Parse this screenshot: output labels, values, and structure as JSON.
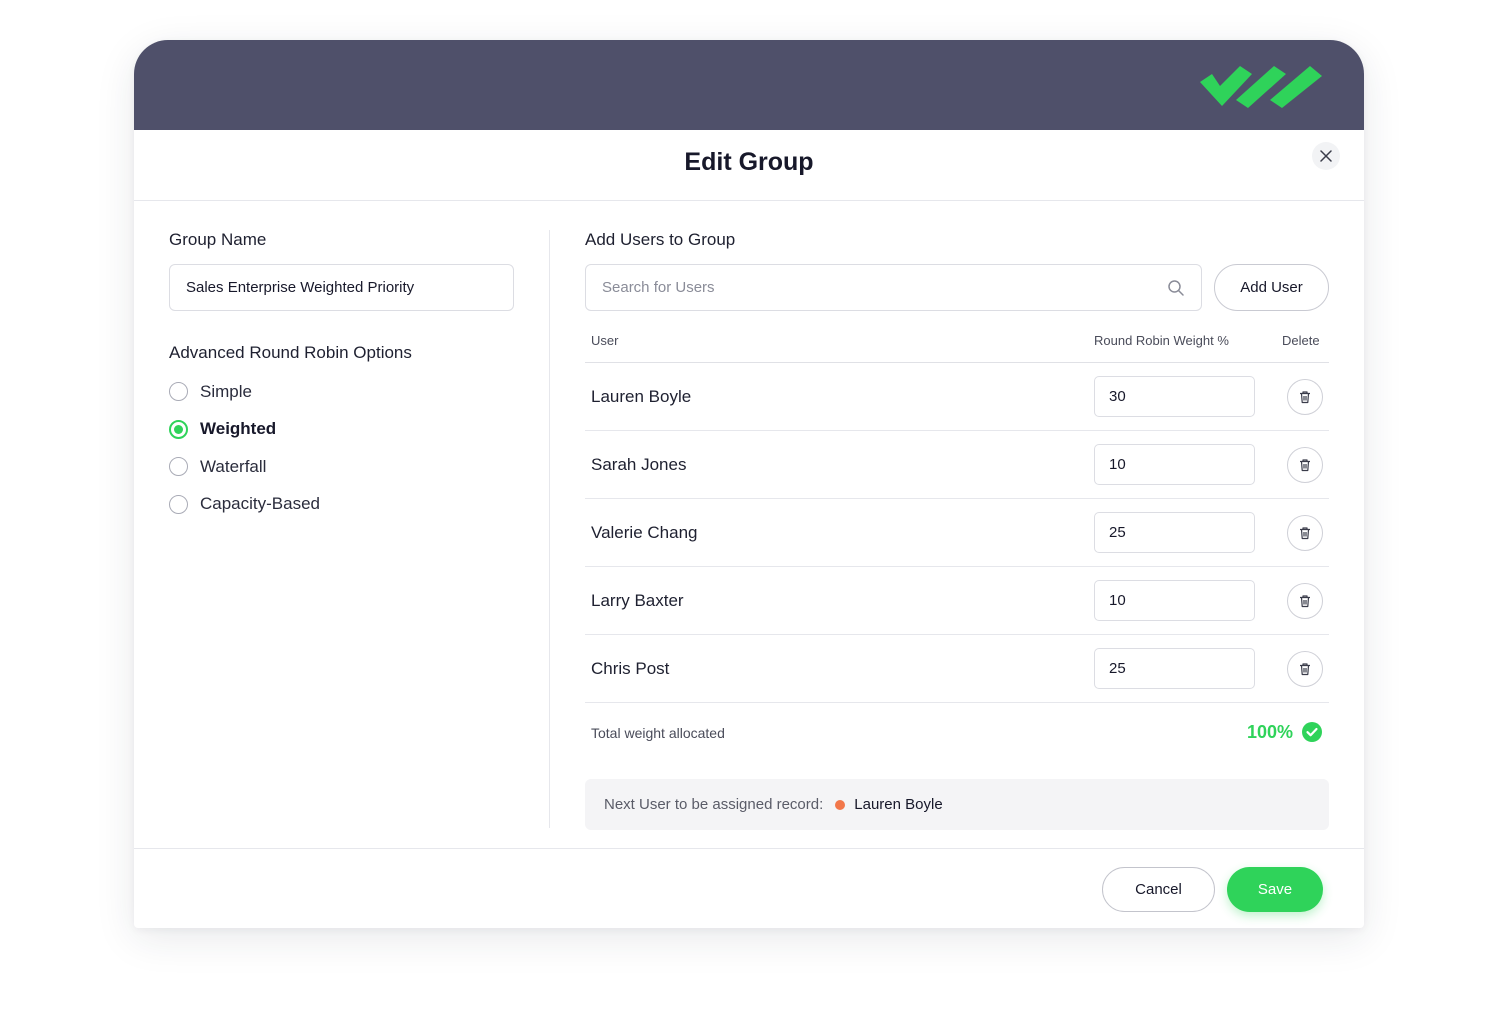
{
  "dialog": {
    "title": "Edit Group",
    "close_icon": "close-icon"
  },
  "colors": {
    "topbar": "#4f506a",
    "accent": "#2fd35a",
    "next_user_dot": "#f2774a"
  },
  "group": {
    "name_label": "Group Name",
    "name_value": "Sales Enterprise Weighted Priority"
  },
  "options": {
    "title": "Advanced Round Robin Options",
    "items": [
      {
        "label": "Simple",
        "selected": false
      },
      {
        "label": "Weighted",
        "selected": true
      },
      {
        "label": "Waterfall",
        "selected": false
      },
      {
        "label": "Capacity-Based",
        "selected": false
      }
    ]
  },
  "users": {
    "title": "Add Users to Group",
    "search_placeholder": "Search for Users",
    "add_user_label": "Add User",
    "columns": {
      "user": "User",
      "weight": "Round Robin Weight %",
      "delete": "Delete"
    },
    "rows": [
      {
        "name": "Lauren Boyle",
        "weight": "30"
      },
      {
        "name": "Sarah Jones",
        "weight": "10"
      },
      {
        "name": "Valerie Chang",
        "weight": "25"
      },
      {
        "name": "Larry Baxter",
        "weight": "10"
      },
      {
        "name": "Chris Post",
        "weight": "25"
      }
    ],
    "total_label": "Total weight allocated",
    "total_value": "100%",
    "next_label": "Next User to be assigned record:",
    "next_user": "Lauren Boyle"
  },
  "footer": {
    "cancel_label": "Cancel",
    "save_label": "Save"
  }
}
